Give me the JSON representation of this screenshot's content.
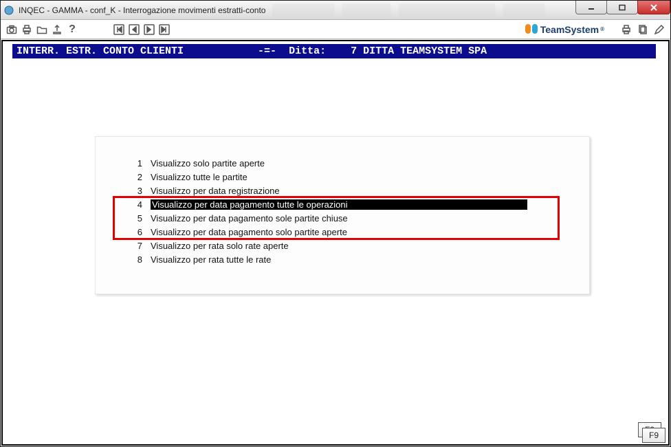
{
  "window": {
    "title": "INQEC - GAMMA - conf_K - Interrogazione movimenti estratti-conto",
    "title_icon": "app-icon"
  },
  "toolbar": {
    "brand_text": "TeamSystem",
    "brand_reg": "®"
  },
  "header_strip": "INTERR. ESTR. CONTO CLIENTI            -=-  Ditta:    7 DITTA TEAMSYSTEM SPA",
  "options": [
    {
      "n": "1",
      "label": "Visualizzo solo partite aperte"
    },
    {
      "n": "2",
      "label": "Visualizzo tutte le partite"
    },
    {
      "n": "3",
      "label": "Visualizzo per data registrazione"
    },
    {
      "n": "4",
      "label": "Visualizzo per data pagamento tutte le operazioni",
      "selected": true
    },
    {
      "n": "5",
      "label": "Visualizzo per data pagamento sole partite chiuse"
    },
    {
      "n": "6",
      "label": "Visualizzo per data pagamento solo partite aperte"
    },
    {
      "n": "7",
      "label": "Visualizzo per rata solo rate aperte"
    },
    {
      "n": "8",
      "label": "Visualizzo per rata tutte le rate"
    }
  ],
  "highlight_frame": {
    "rows_from_index": 3,
    "rows_to_index": 5
  },
  "footer": {
    "f9": "F9"
  }
}
